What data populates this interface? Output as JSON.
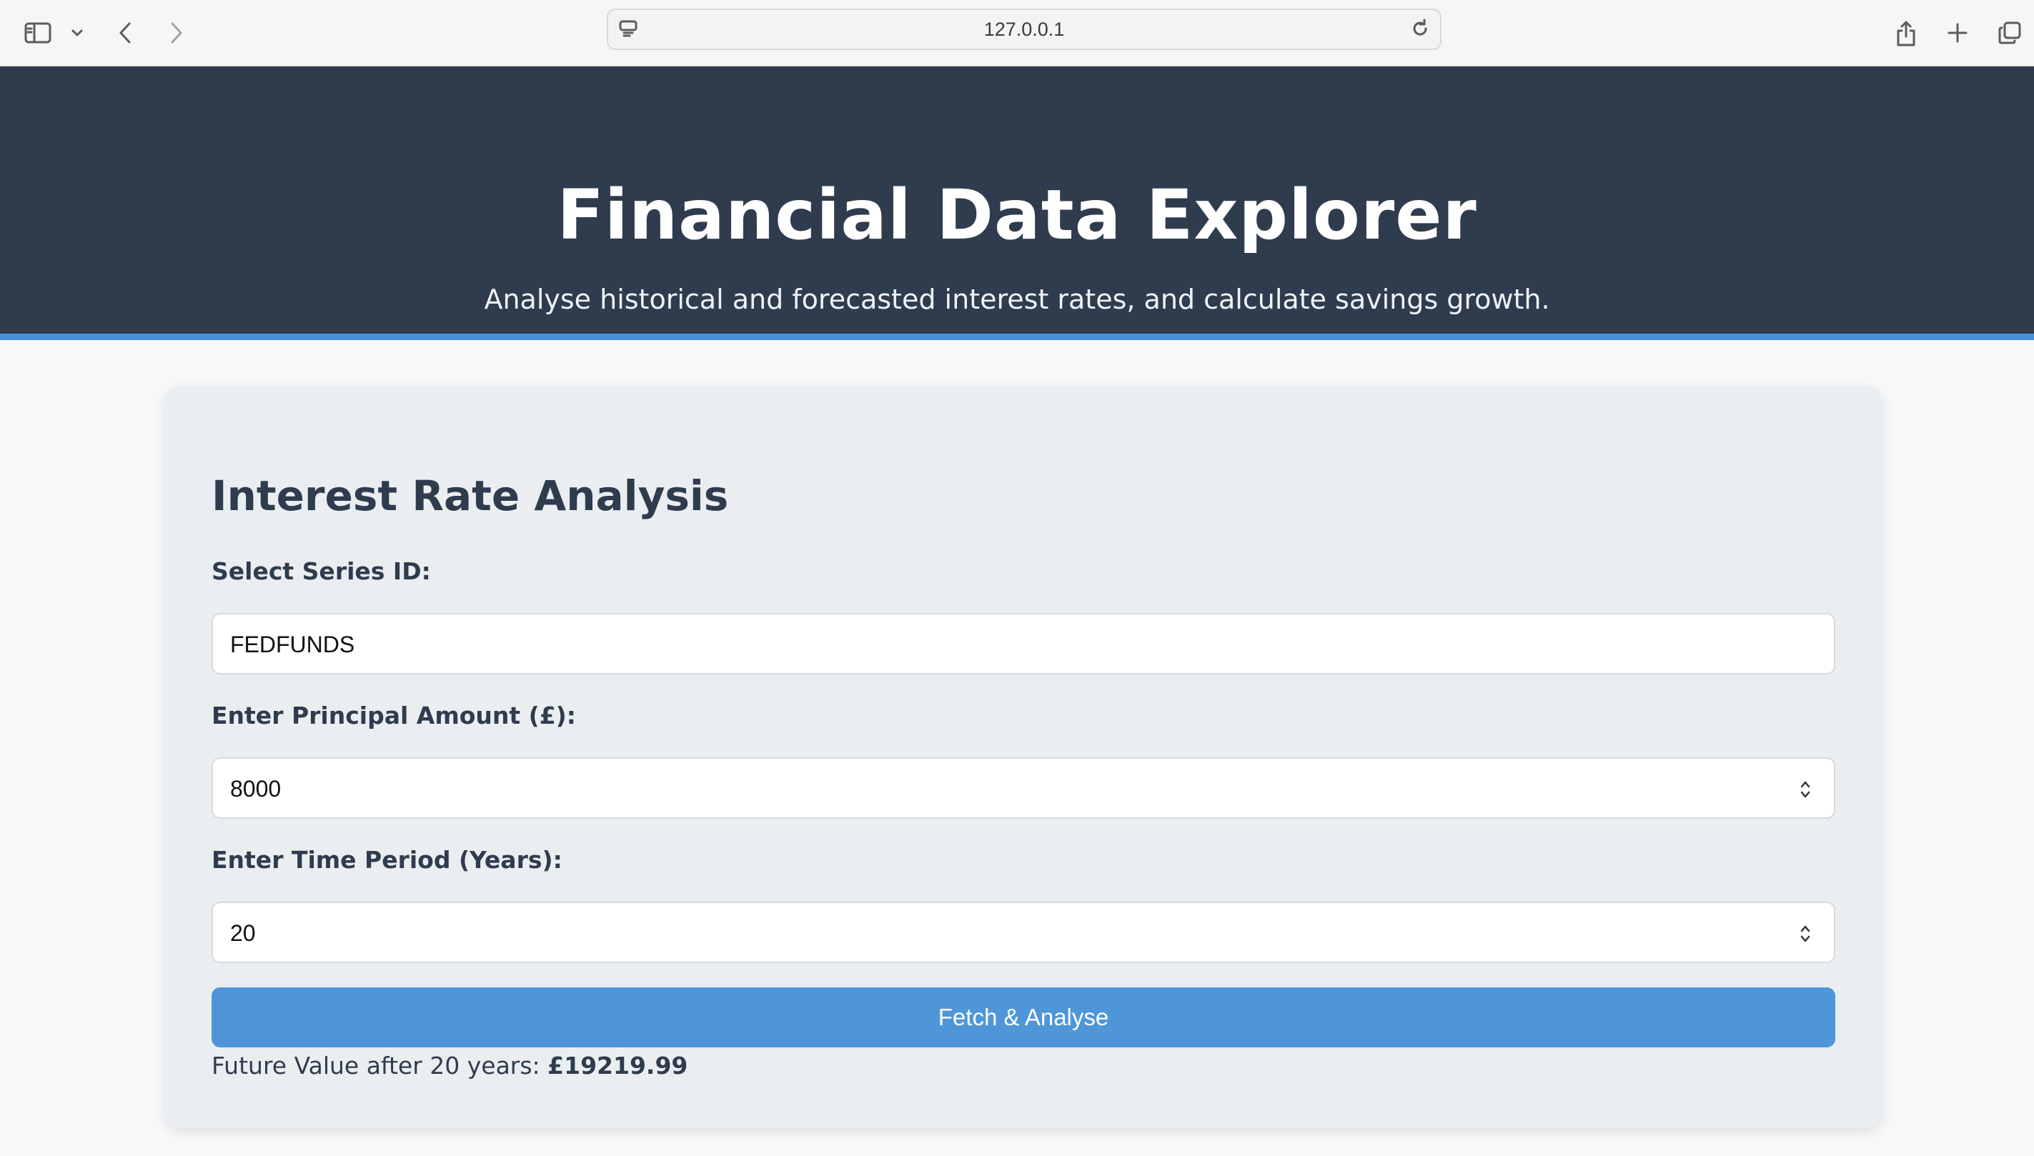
{
  "browser": {
    "url": "127.0.0.1"
  },
  "header": {
    "title": "Financial Data Explorer",
    "subtitle": "Analyse historical and forecasted interest rates, and calculate savings growth."
  },
  "card": {
    "title": "Interest Rate Analysis",
    "series_label": "Select Series ID:",
    "series_value": "FEDFUNDS",
    "principal_label": "Enter Principal Amount (£):",
    "principal_value": "8000",
    "period_label": "Enter Time Period (Years):",
    "period_value": "20",
    "button_label": "Fetch & Analyse",
    "result_prefix": "Future Value after 20 years: ",
    "result_value": "£19219.99"
  },
  "colors": {
    "header_bg": "#2f3c4e",
    "accent": "#4a90d9",
    "button": "#4f96d8",
    "card_bg": "#ebeef0"
  }
}
